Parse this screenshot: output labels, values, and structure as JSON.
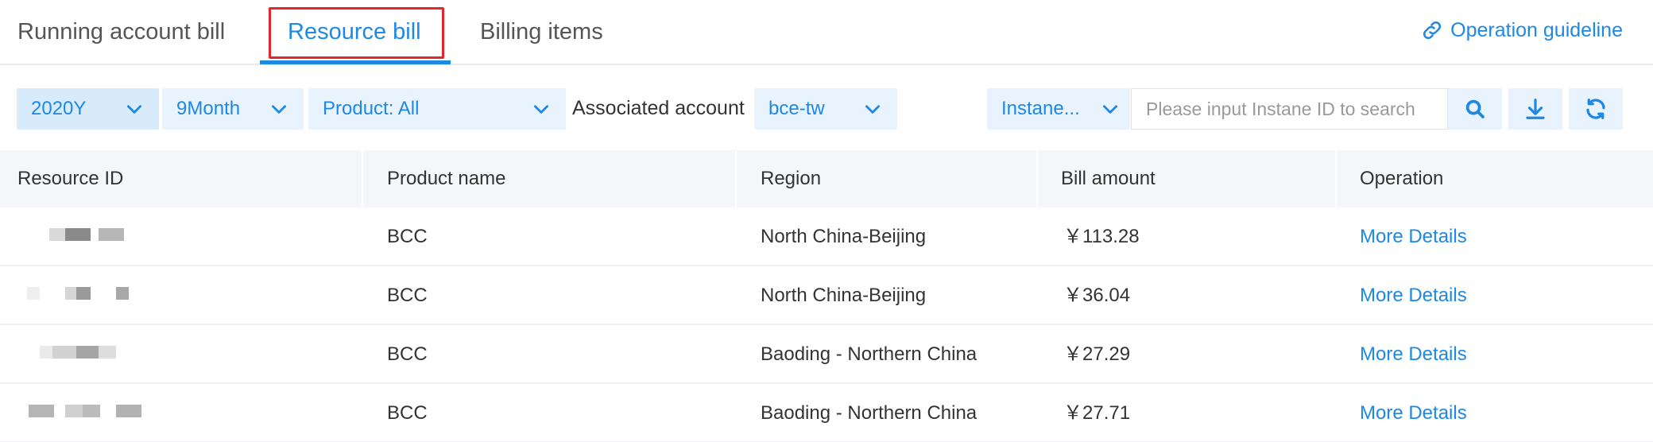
{
  "tabs": [
    {
      "label": "Running account bill"
    },
    {
      "label": "Resource bill"
    },
    {
      "label": "Billing items"
    }
  ],
  "guide": {
    "label": "Operation guideline"
  },
  "filters": {
    "year": "2020Y",
    "month": "9Month",
    "product": "Product: All",
    "associated_account_label": "Associated account",
    "account": "bce-tw",
    "instance_type": "Instane...",
    "search_placeholder": "Please input Instane ID to search"
  },
  "table": {
    "headers": [
      "Resource ID",
      "Product name",
      "Region",
      "Bill amount",
      "Operation"
    ],
    "rows": [
      {
        "product": "BCC",
        "region": "North China-Beijing",
        "amount": "￥113.28",
        "operation": "More Details"
      },
      {
        "product": "BCC",
        "region": "North China-Beijing",
        "amount": "￥36.04",
        "operation": "More Details"
      },
      {
        "product": "BCC",
        "region": "Baoding - Northern China",
        "amount": "￥27.29",
        "operation": "More Details"
      },
      {
        "product": "BCC",
        "region": "Baoding - Northern China",
        "amount": "￥27.71",
        "operation": "More Details"
      }
    ]
  },
  "colors": {
    "accent": "#1e88e5",
    "highlight": "#e3262b",
    "select_bg": "#e8f3fd"
  }
}
